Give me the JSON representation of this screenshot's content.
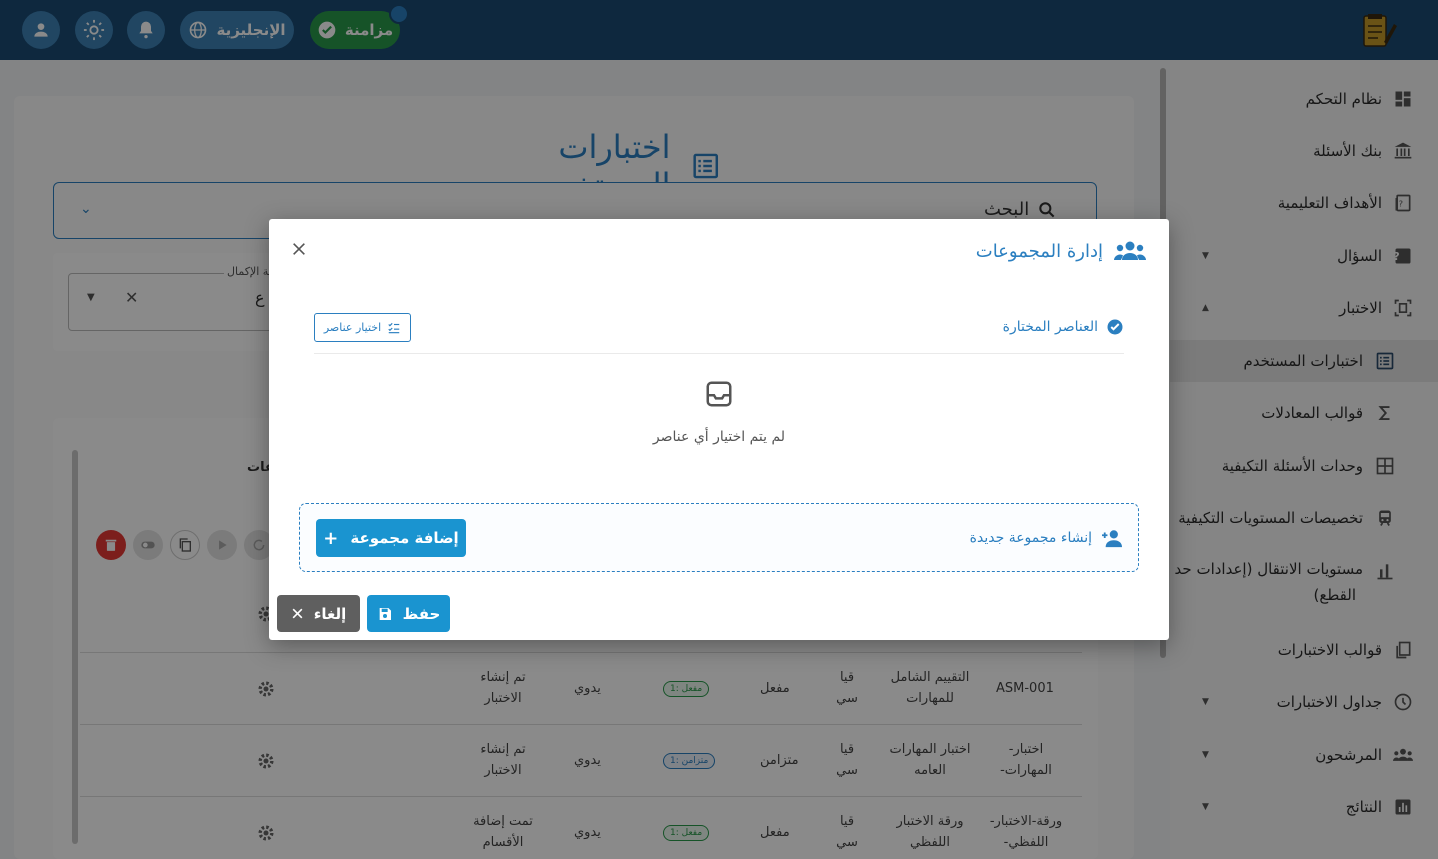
{
  "topbar": {
    "sync_label": "مزامنة",
    "language_label": "الإنجليزية",
    "icons": [
      "user-icon",
      "sun-icon",
      "bell-icon",
      "globe-icon",
      "check-circle-icon",
      "exam-logo"
    ]
  },
  "sidebar": {
    "items": [
      {
        "label": "نظام التحكم",
        "icon": "dashboard-icon"
      },
      {
        "label": "بنك الأسئلة",
        "icon": "bank-icon"
      },
      {
        "label": "الأهداف التعليمية",
        "icon": "book-icon"
      },
      {
        "label": "السؤال",
        "icon": "help-icon"
      },
      {
        "label": "الاختبار",
        "icon": "scan-icon"
      },
      {
        "label": "اختبارات المستخدم",
        "icon": "list-icon",
        "active": true
      },
      {
        "label": "قوالب المعادلات",
        "icon": "sigma-icon"
      },
      {
        "label": "وحدات الأسئلة التكيفية",
        "icon": "grid-icon"
      },
      {
        "label": "تخصيصات المستويات التكيفية",
        "icon": "train-icon"
      },
      {
        "label": "مستويات الانتقال (إعدادات حد",
        "label2": "القطع)",
        "icon": "bar-chart-icon"
      },
      {
        "label": "قوالب الاختبارات",
        "icon": "copy-icon"
      },
      {
        "label": "جداول الاختبارات",
        "icon": "clock-icon"
      },
      {
        "label": "المرشحون",
        "icon": "group-icon"
      },
      {
        "label": "النتائج",
        "icon": "chart-icon"
      }
    ]
  },
  "main": {
    "page_title": "اختبارات المستخدم",
    "search_label": "البحث",
    "filter_label": "حالة الإكمال",
    "filter_value": "ع",
    "table_header_partial": "اعات",
    "rows": [
      {
        "code": "ASM-001",
        "name": "التقييم الشامل للمهارات",
        "type": "قيا سي",
        "status": "مفعل",
        "badge": "مفعل :1",
        "badge_color": "green",
        "mode": "يدوي",
        "note": "تم إنشاء الاختبار"
      },
      {
        "code": "اختبار- المهارات-",
        "name": "اختبار المهارات العامه",
        "type": "قيا سي",
        "status": "متزامن",
        "badge": "متزامن :1",
        "badge_color": "blue",
        "mode": "يدوي",
        "note": "تم إنشاء الاختبار"
      },
      {
        "code": "ورقة-الاختبار- اللفظي-",
        "name": "ورقة الاختبار اللفظي",
        "type": "قيا سي",
        "status": "مفعل",
        "badge": "مفعل :1",
        "badge_color": "green",
        "mode": "يدوي",
        "note": "تمت إضافة الأقسام"
      }
    ]
  },
  "dialog": {
    "title": "إدارة المجموعات",
    "selected_items_label": "العناصر المختارة",
    "select_items_button": "اختيار عناصر",
    "empty_message": "لم يتم اختيار أي عناصر",
    "create_group_label": "إنشاء مجموعة جديدة",
    "add_group_button": "إضافة مجموعة",
    "save_button": "حفظ",
    "cancel_button": "إلغاء"
  },
  "colors": {
    "primary": "#2b7fc0",
    "topbar": "#1a4a73",
    "button": "#1a94d0",
    "sync": "#2a9a4a",
    "cancel": "#5f5f5f"
  }
}
